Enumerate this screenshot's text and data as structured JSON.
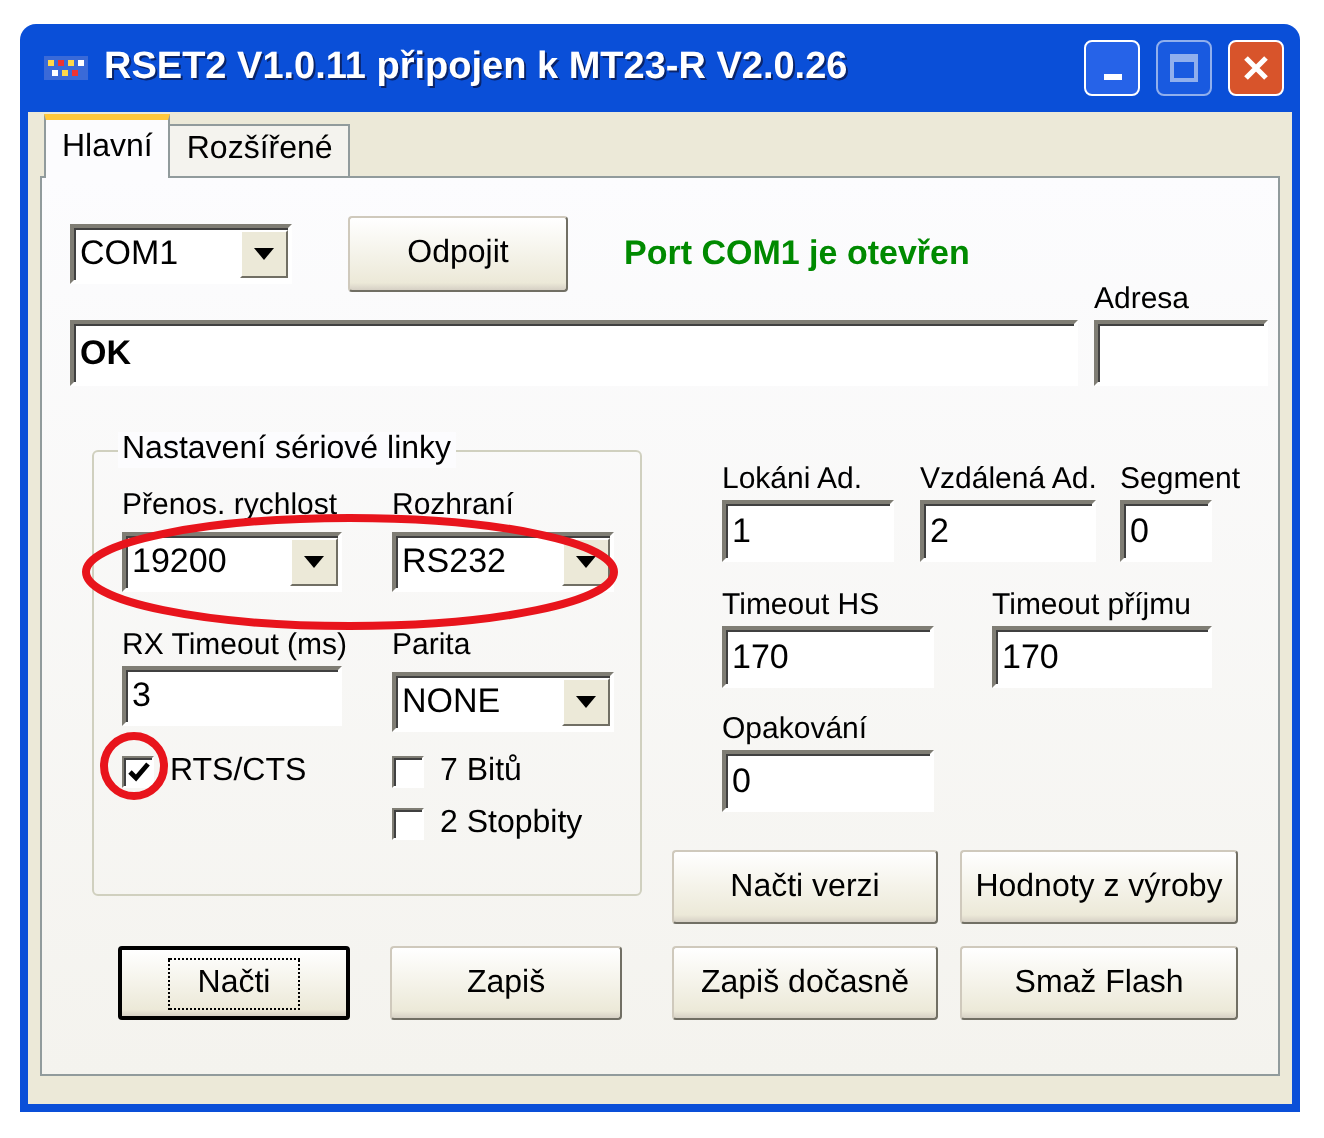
{
  "window": {
    "title": "RSET2 V1.0.11 připojen k MT23-R V2.0.26"
  },
  "tabs": [
    {
      "label": "Hlavní",
      "selected": true
    },
    {
      "label": "Rozšířené",
      "selected": false
    }
  ],
  "port": {
    "value": "COM1"
  },
  "connect_button": "Odpojit",
  "status": "Port COM1 je otevřen",
  "response": {
    "value": "OK"
  },
  "address": {
    "label": "Adresa"
  },
  "serial_group": {
    "title": "Nastavení sériové linky",
    "baud_rate": {
      "label": "Přenos. rychlost",
      "value": "19200"
    },
    "interface": {
      "label": "Rozhraní",
      "value": "RS232"
    },
    "rx_timeout": {
      "label": "RX Timeout (ms)",
      "value": "3"
    },
    "parity": {
      "label": "Parita",
      "value": "NONE"
    },
    "checkboxes": [
      {
        "label": "RTS/CTS",
        "checked": true
      },
      {
        "label": "7 Bitů",
        "checked": false
      },
      {
        "label": "2 Stopbity",
        "checked": false
      }
    ]
  },
  "fields": [
    {
      "label": "Lokáni Ad.",
      "value": "1"
    },
    {
      "label": "Vzdálená Ad.",
      "value": "2"
    },
    {
      "label": "Segment",
      "value": "0"
    },
    {
      "label": "Timeout HS",
      "value": "170"
    },
    {
      "label": "Timeout příjmu",
      "value": "170"
    },
    {
      "label": "Opakování",
      "value": "0"
    }
  ],
  "buttons": [
    {
      "label": "Načti verzi",
      "default": false
    },
    {
      "label": "Hodnoty z výroby",
      "default": false
    },
    {
      "label": "Načti",
      "default": true
    },
    {
      "label": "Zapiš",
      "default": false
    },
    {
      "label": "Zapiš dočasně",
      "default": false
    },
    {
      "label": "Smaž Flash",
      "default": false
    }
  ],
  "annotations": [
    {
      "kind": "ellipse"
    },
    {
      "kind": "circle"
    }
  ]
}
